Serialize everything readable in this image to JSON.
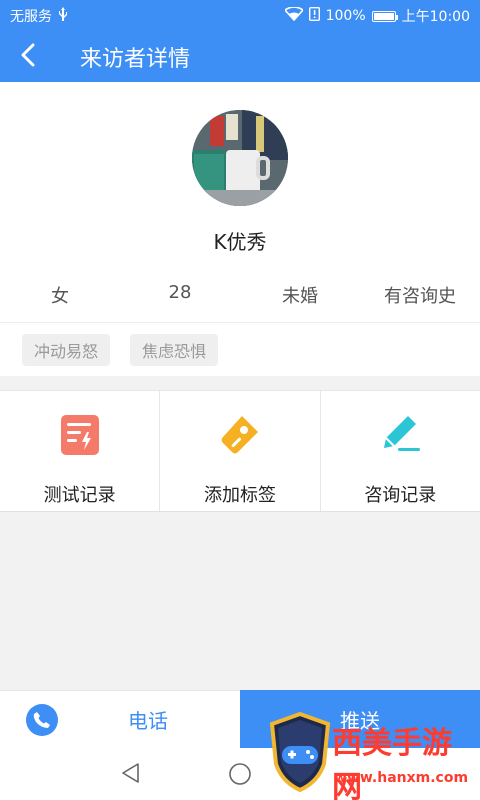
{
  "status_bar": {
    "carrier": "无服务",
    "usb_icon": "usb-icon",
    "wifi_icon": "wifi-icon",
    "battery_percent": "100%",
    "battery_level": 1.0,
    "time": "上午10:00"
  },
  "header": {
    "title": "来访者详情",
    "back_icon": "back-chevron-icon",
    "background_color": "#3d8ef5"
  },
  "profile": {
    "avatar_icon": "avatar-photo",
    "name": "K优秀",
    "gender": "女",
    "age": "28",
    "marital_status": "未婚",
    "consult_history": "有咨询史"
  },
  "tags": [
    "冲动易怒",
    "焦虑恐惧"
  ],
  "actions": [
    {
      "label": "测试记录",
      "icon": "test-record-icon",
      "color": "#f26b5b"
    },
    {
      "label": "添加标签",
      "icon": "tag-icon",
      "color": "#f5b123"
    },
    {
      "label": "咨询记录",
      "icon": "edit-pen-icon",
      "color": "#2bc5d6"
    }
  ],
  "bottom_bar": {
    "call_label": "电话",
    "call_icon": "phone-icon",
    "push_label": "推送"
  },
  "nav_bar": {
    "back_icon": "nav-back-triangle-icon",
    "home_icon": "nav-home-circle-icon"
  },
  "watermark": {
    "title": "西美手游网",
    "url": "www.hanxm.com"
  }
}
